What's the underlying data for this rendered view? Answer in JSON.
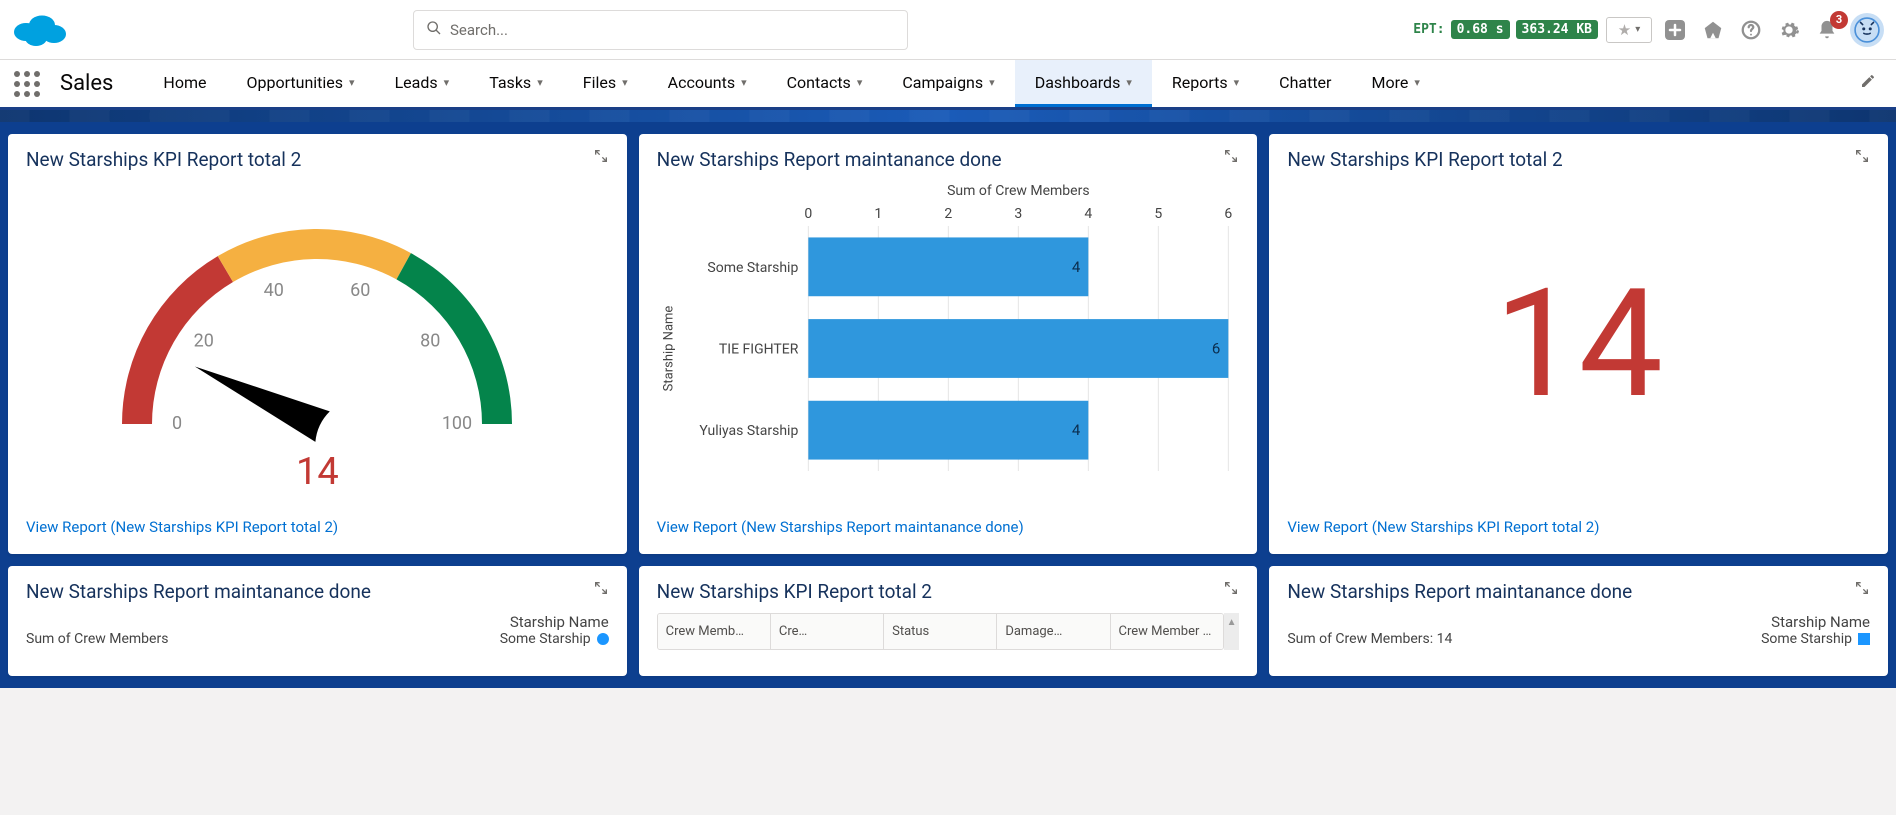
{
  "header": {
    "search_placeholder": "Search...",
    "ept_label": "EPT:",
    "ept_time": "0.68 s",
    "ept_size": "363.24 KB",
    "notif_count": "3"
  },
  "nav": {
    "app_name": "Sales",
    "active": "Dashboards",
    "items": [
      "Home",
      "Opportunities",
      "Leads",
      "Tasks",
      "Files",
      "Accounts",
      "Contacts",
      "Campaigns",
      "Dashboards",
      "Reports",
      "Chatter",
      "More"
    ]
  },
  "cards": {
    "gauge": {
      "title": "New Starships KPI Report total 2",
      "value": "14",
      "link": "View Report (New Starships KPI Report total 2)"
    },
    "hbar": {
      "title": "New Starships Report maintanance done",
      "axis_title": "Sum of Crew Members",
      "y_axis_title": "Starship Name",
      "link": "View Report (New Starships Report maintanance done)"
    },
    "metric": {
      "title": "New Starships KPI Report total 2",
      "value": "14",
      "link": "View Report (New Starships KPI Report total 2)"
    },
    "r2a": {
      "title": "New Starships Report maintanance done",
      "sum_label": "Sum of Crew Members",
      "legend_title": "Starship Name",
      "legend_item": "Some Starship"
    },
    "r2b": {
      "title": "New Starships KPI Report total 2",
      "cols": [
        "Crew Memb…",
        "Cre…",
        "Status",
        "Damage…",
        "Crew Member …"
      ]
    },
    "r2c": {
      "title": "New Starships Report maintanance done",
      "sum_label": "Sum of Crew Members: 14",
      "legend_title": "Starship Name",
      "legend_item": "Some Starship"
    }
  },
  "chart_data": [
    {
      "id": "gauge",
      "type": "gauge",
      "value": 14,
      "min": 0,
      "max": 100,
      "ticks": [
        0,
        20,
        40,
        60,
        80,
        100
      ],
      "bands": [
        {
          "from": 0,
          "to": 33,
          "color": "#c23934"
        },
        {
          "from": 33,
          "to": 66,
          "color": "#f5b041"
        },
        {
          "from": 66,
          "to": 100,
          "color": "#04844b"
        }
      ],
      "title": "New Starships KPI Report total 2"
    },
    {
      "id": "hbar",
      "type": "bar",
      "orientation": "horizontal",
      "title": "New Starships Report maintanance done",
      "xlabel": "Sum of Crew Members",
      "ylabel": "Starship Name",
      "xlim": [
        0,
        6
      ],
      "ticks": [
        0,
        1,
        2,
        3,
        4,
        5,
        6
      ],
      "categories": [
        "Some Starship",
        "TIE FIGHTER",
        "Yuliyas Starship"
      ],
      "values": [
        4,
        6,
        4
      ]
    },
    {
      "id": "metric",
      "type": "metric",
      "title": "New Starships KPI Report total 2",
      "value": 14
    }
  ]
}
